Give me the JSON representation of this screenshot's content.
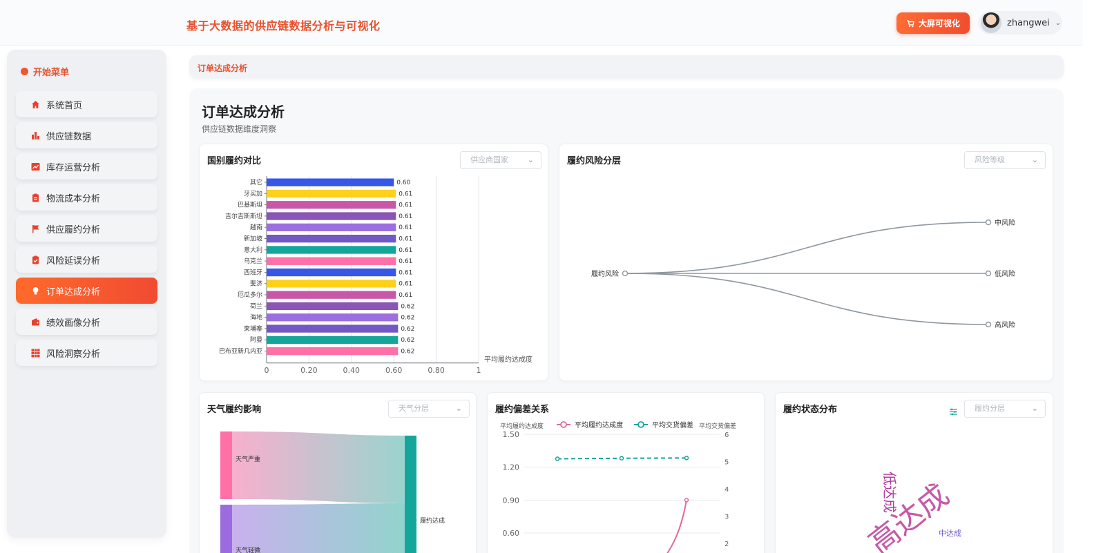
{
  "app": {
    "title": "基于大数据的供应链数据分析与可视化"
  },
  "header": {
    "bigscreen_label": "大屏可视化",
    "username": "zhangwei"
  },
  "sidebar": {
    "heading": "开始菜单",
    "items": [
      {
        "label": "系统首页",
        "icon": "home-icon"
      },
      {
        "label": "供应链数据",
        "icon": "bar-chart-icon"
      },
      {
        "label": "库存运营分析",
        "icon": "line-chart-icon"
      },
      {
        "label": "物流成本分析",
        "icon": "clipboard-icon"
      },
      {
        "label": "供应履约分析",
        "icon": "flag-icon"
      },
      {
        "label": "风险延误分析",
        "icon": "clipboard-check-icon"
      },
      {
        "label": "订单达成分析",
        "icon": "lightbulb-icon",
        "active": true
      },
      {
        "label": "绩效画像分析",
        "icon": "wallet-icon"
      },
      {
        "label": "风险洞察分析",
        "icon": "grid-icon"
      }
    ]
  },
  "breadcrumb": {
    "current": "订单达成分析"
  },
  "page": {
    "title": "订单达成分析",
    "subtitle": "供应链数据维度洞察"
  },
  "cards": {
    "country": {
      "title": "国别履约对比",
      "select_placeholder": "供应商国家"
    },
    "risk": {
      "title": "履约风险分层",
      "select_placeholder": "风险等级"
    },
    "weather": {
      "title": "天气履约影响",
      "select_placeholder": "天气分层"
    },
    "deviation": {
      "title": "履约偏差关系"
    },
    "status": {
      "title": "履约状态分布",
      "select_placeholder": "履约分层"
    }
  },
  "colors": {
    "accent": "#f04e2f",
    "accent_light": "#ff6b35",
    "tree_line": "#8e979f",
    "palette": [
      "#3657e8",
      "#ffd11a",
      "#c957a8",
      "#8a55b5",
      "#9c6ee0",
      "#7357c5",
      "#14a69a",
      "#ff6fa8"
    ]
  },
  "chart_data": [
    {
      "type": "bar",
      "orientation": "horizontal",
      "categories": [
        "其它",
        "牙买加",
        "巴基斯坦",
        "吉尔吉斯斯坦",
        "越南",
        "新加坡",
        "意大利",
        "乌克兰",
        "西班牙",
        "斐济",
        "厄瓜多尔",
        "荷兰",
        "海地",
        "柬埔寨",
        "阿曼",
        "巴布亚新几内亚"
      ],
      "values": [
        0.6,
        0.61,
        0.61,
        0.61,
        0.61,
        0.61,
        0.61,
        0.61,
        0.61,
        0.61,
        0.61,
        0.62,
        0.62,
        0.62,
        0.62,
        0.62
      ],
      "value_labels": [
        "0.60",
        "0.61",
        "0.61",
        "0.61",
        "0.61",
        "0.61",
        "0.61",
        "0.61",
        "0.61",
        "0.61",
        "0.61",
        "0.62",
        "0.62",
        "0.62",
        "0.62",
        "0.62"
      ],
      "x_ticks": [
        "0",
        "0.20",
        "0.40",
        "0.60",
        "0.80",
        "1"
      ],
      "xlim": [
        0,
        1
      ],
      "xlabel": "平均履约达成度",
      "grid": true
    },
    {
      "type": "tree",
      "root": "履约风险",
      "children": [
        "中风险",
        "低风险",
        "高风险"
      ]
    },
    {
      "type": "sankey",
      "sources": [
        "天气严重",
        "天气轻微"
      ],
      "targets": [
        "履约达成"
      ]
    },
    {
      "type": "line",
      "legend": [
        "平均履约达成度",
        "平均交货偏差"
      ],
      "y_left_label": "平均履约达成度",
      "y_right_label": "平均交货偏差",
      "y_left_ticks": [
        "1.50",
        "1.20",
        "0.90",
        "0.60"
      ],
      "y_right_ticks": [
        "6",
        "5",
        "4",
        "3",
        "2"
      ],
      "ylim_left": [
        0.6,
        1.5
      ],
      "ylim_right": [
        2,
        6
      ],
      "series": [
        {
          "name": "平均交货偏差",
          "axis": "right",
          "style": "dashed",
          "values": [
            5.1,
            5.12,
            5.13
          ]
        },
        {
          "name": "平均履约达成度",
          "axis": "left",
          "style": "solid",
          "values": [
            0.5,
            0.5,
            0.9
          ]
        }
      ]
    },
    {
      "type": "wordcloud",
      "words": [
        "低达成",
        "高达成",
        "中达成"
      ]
    }
  ]
}
